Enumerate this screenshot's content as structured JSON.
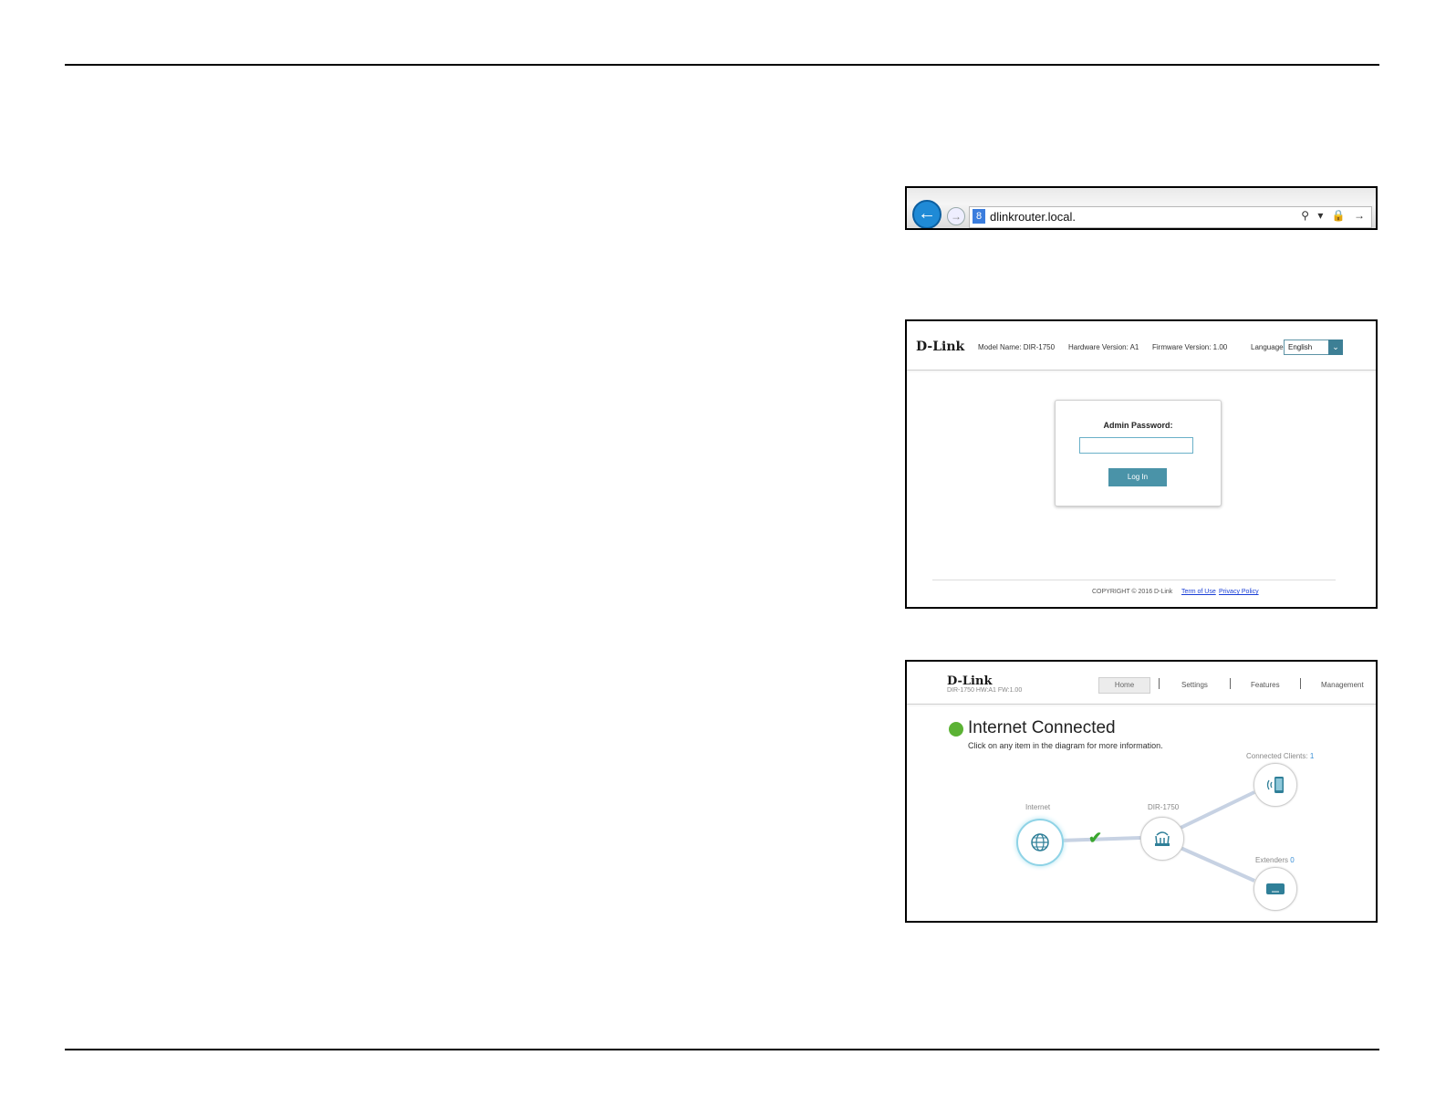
{
  "browser": {
    "url": "dlinkrouter.local.",
    "back_icon": "←",
    "forward_icon": "→",
    "search_engine_icon": "8",
    "address_icons": "⚲ ▾ 🔒 →"
  },
  "login": {
    "logo": "D-Link",
    "model_name": "Model Name: DIR-1750",
    "hardware_version": "Hardware Version: A1",
    "firmware_version": "Firmware Version: 1.00",
    "language_label": "Language",
    "language_value": "English",
    "dropdown_icon": "⌄",
    "admin_password_label": "Admin Password:",
    "login_button": "Log In",
    "copyright": "COPYRIGHT © 2016 D-Link",
    "terms_link": "Term of Use",
    "privacy_link": "Privacy Policy"
  },
  "home": {
    "logo": "D-Link",
    "model_line": "DIR-1750 HW:A1 FW:1.00",
    "nav": [
      "Home",
      "Settings",
      "Features",
      "Management"
    ],
    "status_title": "Internet Connected",
    "status_sub": "Click on any item in the diagram for more information.",
    "internet_label": "Internet",
    "router_label": "DIR-1750",
    "clients_label": "Connected Clients:",
    "clients_count": "1",
    "extenders_label": "Extenders",
    "extenders_count": "0",
    "check_icon": "✔"
  },
  "colors": {
    "accent": "#4a93a8",
    "status_green": "#5bb234",
    "link_blue": "#1a3fd6"
  }
}
